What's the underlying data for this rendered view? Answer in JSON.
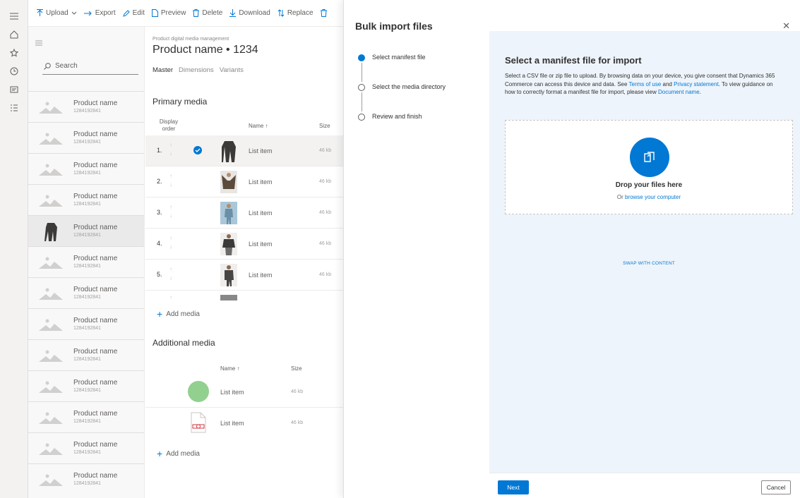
{
  "toolbar": {
    "items": [
      {
        "label": "Upload",
        "icon": "upload-icon",
        "has_dropdown": true
      },
      {
        "label": "Export",
        "icon": "export-icon"
      },
      {
        "label": "Edit",
        "icon": "edit-icon"
      },
      {
        "label": "Preview",
        "icon": "preview-icon"
      },
      {
        "label": "Delete",
        "icon": "delete-icon"
      },
      {
        "label": "Download",
        "icon": "download-icon"
      },
      {
        "label": "Replace",
        "icon": "replace-icon"
      }
    ]
  },
  "rail": {
    "icons": [
      "hamburger-icon",
      "home-icon",
      "star-icon",
      "recent-icon",
      "workspace-icon",
      "list-icon"
    ]
  },
  "product_list": {
    "search_placeholder": "Search",
    "items": [
      {
        "name": "Product name",
        "id": "1284192841",
        "selected": false
      },
      {
        "name": "Product name",
        "id": "1284192841",
        "selected": false
      },
      {
        "name": "Product name",
        "id": "1284192841",
        "selected": false
      },
      {
        "name": "Product name",
        "id": "1284192841",
        "selected": false
      },
      {
        "name": "Product name",
        "id": "1284192841",
        "selected": true
      },
      {
        "name": "Product name",
        "id": "1284192841",
        "selected": false
      },
      {
        "name": "Product name",
        "id": "1284192841",
        "selected": false
      },
      {
        "name": "Product name",
        "id": "1284192841",
        "selected": false
      },
      {
        "name": "Product name",
        "id": "1284192841",
        "selected": false
      },
      {
        "name": "Product name",
        "id": "1284192841",
        "selected": false
      },
      {
        "name": "Product name",
        "id": "1284192841",
        "selected": false
      },
      {
        "name": "Product name",
        "id": "1284192841",
        "selected": false
      },
      {
        "name": "Product name",
        "id": "1284192841",
        "selected": false
      }
    ]
  },
  "detail": {
    "breadcrumb": "Product digital media management",
    "title": "Product name • 1234",
    "tabs": [
      "Master",
      "Dimensions",
      "Variants"
    ],
    "primary_media_title": "Primary media",
    "col_display_order": "Display order",
    "col_name": "Name ↑",
    "col_size": "Size",
    "primary_rows": [
      {
        "order": "1.",
        "name": "List item",
        "size": "46 kb",
        "selected": true
      },
      {
        "order": "2.",
        "name": "List item",
        "size": "46 kb",
        "selected": false
      },
      {
        "order": "3.",
        "name": "List item",
        "size": "46 kb",
        "selected": false
      },
      {
        "order": "4.",
        "name": "List item",
        "size": "46 kb",
        "selected": false
      },
      {
        "order": "5.",
        "name": "List item",
        "size": "46 kb",
        "selected": false
      }
    ],
    "add_media": "Add media",
    "additional_media_title": "Additional media",
    "additional_rows": [
      {
        "name": "List item",
        "size": "46 kb",
        "thumb": "green-circle"
      },
      {
        "name": "List item",
        "size": "46 kb",
        "thumb": "document-icon"
      }
    ]
  },
  "dialog": {
    "title": "Bulk import files",
    "steps": [
      {
        "label": "Select manifest file",
        "active": true
      },
      {
        "label": "Select the media directory",
        "active": false
      },
      {
        "label": "Review and finish",
        "active": false
      }
    ],
    "heading": "Select a manifest file for import",
    "desc_part1": "Select a CSV file or zip file to upload. By browsing data on your device, you give consent that Dynamics 365 Commerce can access this device and data. See ",
    "link_terms": "Terms of use",
    "desc_and": " and ",
    "link_privacy": "Privacy statement",
    "desc_part2": ". To view guidance on how to correctly format a manifest file for import, please view ",
    "link_doc": "Document name",
    "desc_end": ".",
    "drop_title": "Drop your files here",
    "drop_or": "Or ",
    "drop_link": "browse your computer",
    "swap": "SWAP WITH CONTENT",
    "next": "Next",
    "cancel": "Cancel"
  },
  "colors": {
    "accent": "#0078d4",
    "pane_bg": "#eef4fb",
    "green": "#92d08f"
  }
}
